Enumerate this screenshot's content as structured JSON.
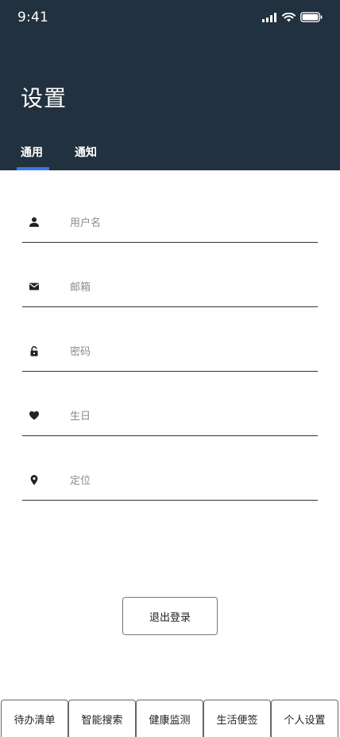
{
  "status_bar": {
    "time": "9:41"
  },
  "header": {
    "title": "设置",
    "background": "#22313f"
  },
  "tabs": [
    {
      "label": "通用",
      "active": true
    },
    {
      "label": "通知",
      "active": false
    }
  ],
  "accent_color": "#3b78e7",
  "form": {
    "fields": [
      {
        "icon": "user-icon",
        "placeholder": "用户名",
        "value": ""
      },
      {
        "icon": "mail-icon",
        "placeholder": "邮箱",
        "value": ""
      },
      {
        "icon": "lock-icon",
        "placeholder": "密码",
        "value": ""
      },
      {
        "icon": "heart-icon",
        "placeholder": "生日",
        "value": ""
      },
      {
        "icon": "location-pin-icon",
        "placeholder": "定位",
        "value": ""
      }
    ]
  },
  "logout_button": {
    "label": "退出登录"
  },
  "bottom_nav": {
    "items": [
      {
        "label": "待办清单"
      },
      {
        "label": "智能搜索"
      },
      {
        "label": "健康监测"
      },
      {
        "label": "生活便签"
      },
      {
        "label": "个人设置"
      }
    ]
  }
}
